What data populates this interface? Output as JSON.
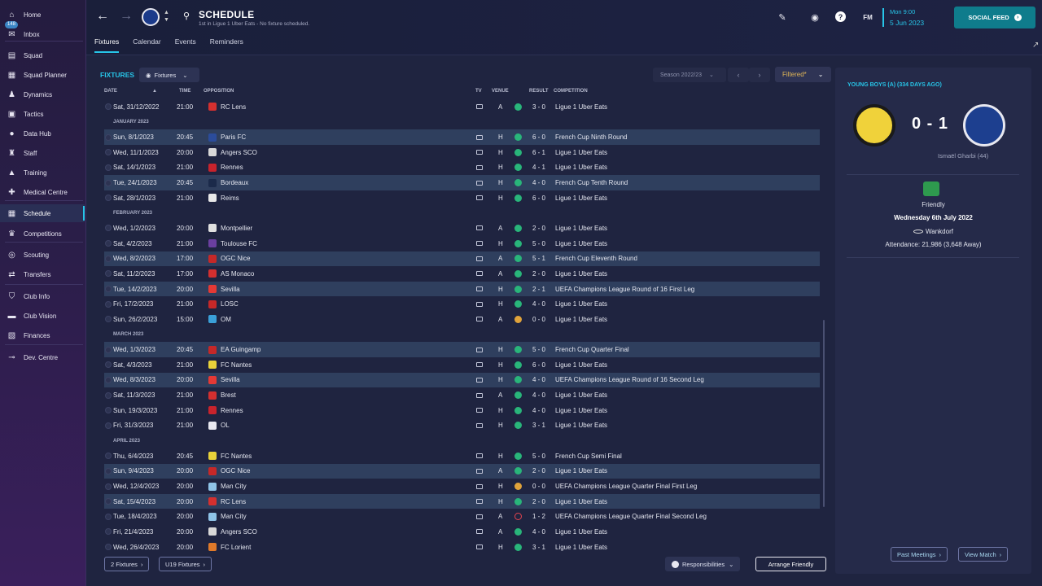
{
  "sidebar": {
    "items": [
      {
        "label": "Home",
        "icon": "home-icon"
      },
      {
        "label": "Inbox",
        "icon": "inbox-icon",
        "badge": "148"
      },
      {
        "label": "Squad",
        "icon": "shirt-icon"
      },
      {
        "label": "Squad Planner",
        "icon": "squad-planner-icon"
      },
      {
        "label": "Dynamics",
        "icon": "dynamics-icon"
      },
      {
        "label": "Tactics",
        "icon": "tactics-icon"
      },
      {
        "label": "Data Hub",
        "icon": "data-hub-icon"
      },
      {
        "label": "Staff",
        "icon": "staff-icon"
      },
      {
        "label": "Training",
        "icon": "training-icon"
      },
      {
        "label": "Medical Centre",
        "icon": "medical-icon"
      },
      {
        "label": "Schedule",
        "icon": "calendar-icon"
      },
      {
        "label": "Competitions",
        "icon": "trophy-icon"
      },
      {
        "label": "Scouting",
        "icon": "scouting-icon"
      },
      {
        "label": "Transfers",
        "icon": "transfers-icon"
      },
      {
        "label": "Club Info",
        "icon": "shield-icon"
      },
      {
        "label": "Club Vision",
        "icon": "club-vision-icon"
      },
      {
        "label": "Finances",
        "icon": "finances-icon"
      },
      {
        "label": "Dev. Centre",
        "icon": "dev-centre-icon"
      }
    ]
  },
  "header": {
    "title": "SCHEDULE",
    "subtitle": "1st in Ligue 1 Uber Eats - No fixture scheduled.",
    "tabs": [
      "Fixtures",
      "Calendar",
      "Events",
      "Reminders"
    ],
    "date_line1": "Mon 9:00",
    "date_line2": "5 Jun 2023",
    "fm_label": "FM",
    "social_label": "SOCIAL FEED"
  },
  "fixtures": {
    "label": "FIXTURES",
    "view_dropdown": "Fixtures",
    "season": "Season 2022/23",
    "filter": "Filtered*",
    "columns": {
      "date": "DATE",
      "time": "TIME",
      "opposition": "OPPOSITION",
      "tv": "TV",
      "venue": "VENUE",
      "result": "RESULT",
      "competition": "COMPETITION"
    },
    "rows": [
      {
        "date": "Sat, 31/12/2022",
        "time": "21:00",
        "opp": "RC Lens",
        "venue": "A",
        "res": "W",
        "score": "3 - 0",
        "comp": "Ligue 1 Uber Eats",
        "crest": "#d4302f"
      },
      {
        "section": "JANUARY 2023"
      },
      {
        "date": "Sun, 8/1/2023",
        "time": "20:45",
        "opp": "Paris FC",
        "venue": "H",
        "res": "W",
        "score": "6 - 0",
        "comp": "French Cup Ninth Round",
        "crest": "#2b4c9b"
      },
      {
        "date": "Wed, 11/1/2023",
        "time": "20:00",
        "opp": "Angers SCO",
        "venue": "H",
        "res": "W",
        "score": "6 - 1",
        "comp": "Ligue 1 Uber Eats",
        "crest": "#d8d8d8"
      },
      {
        "date": "Sat, 14/1/2023",
        "time": "21:00",
        "opp": "Rennes",
        "venue": "H",
        "res": "W",
        "score": "4 - 1",
        "comp": "Ligue 1 Uber Eats",
        "crest": "#c8232c"
      },
      {
        "date": "Tue, 24/1/2023",
        "time": "20:45",
        "opp": "Bordeaux",
        "venue": "H",
        "res": "W",
        "score": "4 - 0",
        "comp": "French Cup Tenth Round",
        "crest": "#1b2a4a"
      },
      {
        "date": "Sat, 28/1/2023",
        "time": "21:00",
        "opp": "Reims",
        "venue": "H",
        "res": "W",
        "score": "6 - 0",
        "comp": "Ligue 1 Uber Eats",
        "crest": "#e8e8e8"
      },
      {
        "section": "FEBRUARY 2023"
      },
      {
        "date": "Wed, 1/2/2023",
        "time": "20:00",
        "opp": "Montpellier",
        "venue": "A",
        "res": "W",
        "score": "2 - 0",
        "comp": "Ligue 1 Uber Eats",
        "crest": "#e0e0e0"
      },
      {
        "date": "Sat, 4/2/2023",
        "time": "21:00",
        "opp": "Toulouse FC",
        "venue": "H",
        "res": "W",
        "score": "5 - 0",
        "comp": "Ligue 1 Uber Eats",
        "crest": "#6b3fa0"
      },
      {
        "date": "Wed, 8/2/2023",
        "time": "17:00",
        "opp": "OGC Nice",
        "venue": "A",
        "res": "W",
        "score": "5 - 1",
        "comp": "French Cup Eleventh Round",
        "crest": "#c62828"
      },
      {
        "date": "Sat, 11/2/2023",
        "time": "17:00",
        "opp": "AS Monaco",
        "venue": "A",
        "res": "W",
        "score": "2 - 0",
        "comp": "Ligue 1 Uber Eats",
        "crest": "#d32f2f"
      },
      {
        "date": "Tue, 14/2/2023",
        "time": "20:00",
        "opp": "Sevilla",
        "venue": "H",
        "res": "W",
        "score": "2 - 1",
        "comp": "UEFA Champions League Round of 16  First Leg",
        "crest": "#e53935"
      },
      {
        "date": "Fri, 17/2/2023",
        "time": "21:00",
        "opp": "LOSC",
        "venue": "H",
        "res": "W",
        "score": "4 - 0",
        "comp": "Ligue 1 Uber Eats",
        "crest": "#c62828"
      },
      {
        "date": "Sun, 26/2/2023",
        "time": "15:00",
        "opp": "OM",
        "venue": "A",
        "res": "D",
        "score": "0 - 0",
        "comp": "Ligue 1 Uber Eats",
        "crest": "#3aa0d8"
      },
      {
        "section": "MARCH 2023"
      },
      {
        "date": "Wed, 1/3/2023",
        "time": "20:45",
        "opp": "EA Guingamp",
        "venue": "H",
        "res": "W",
        "score": "5 - 0",
        "comp": "French Cup Quarter Final",
        "crest": "#c62828"
      },
      {
        "date": "Sat, 4/3/2023",
        "time": "21:00",
        "opp": "FC Nantes",
        "venue": "H",
        "res": "W",
        "score": "6 - 0",
        "comp": "Ligue 1 Uber Eats",
        "crest": "#e8d23a"
      },
      {
        "date": "Wed, 8/3/2023",
        "time": "20:00",
        "opp": "Sevilla",
        "venue": "H",
        "res": "W",
        "score": "4 - 0",
        "comp": "UEFA Champions League Round of 16  Second Leg",
        "crest": "#e53935"
      },
      {
        "date": "Sat, 11/3/2023",
        "time": "21:00",
        "opp": "Brest",
        "venue": "A",
        "res": "W",
        "score": "4 - 0",
        "comp": "Ligue 1 Uber Eats",
        "crest": "#d32f2f"
      },
      {
        "date": "Sun, 19/3/2023",
        "time": "21:00",
        "opp": "Rennes",
        "venue": "H",
        "res": "W",
        "score": "4 - 0",
        "comp": "Ligue 1 Uber Eats",
        "crest": "#c8232c"
      },
      {
        "date": "Fri, 31/3/2023",
        "time": "21:00",
        "opp": "OL",
        "venue": "H",
        "res": "W",
        "score": "3 - 1",
        "comp": "Ligue 1 Uber Eats",
        "crest": "#e8e8f0"
      },
      {
        "section": "APRIL 2023"
      },
      {
        "date": "Thu, 6/4/2023",
        "time": "20:45",
        "opp": "FC Nantes",
        "venue": "H",
        "res": "W",
        "score": "5 - 0",
        "comp": "French Cup Semi Final",
        "crest": "#e8d23a"
      },
      {
        "date": "Sun, 9/4/2023",
        "time": "20:00",
        "opp": "OGC Nice",
        "venue": "A",
        "res": "W",
        "score": "2 - 0",
        "comp": "Ligue 1 Uber Eats",
        "crest": "#c62828"
      },
      {
        "date": "Wed, 12/4/2023",
        "time": "20:00",
        "opp": "Man City",
        "venue": "H",
        "res": "D",
        "score": "0 - 0",
        "comp": "UEFA Champions League Quarter Final First Leg",
        "crest": "#8fc4e8"
      },
      {
        "date": "Sat, 15/4/2023",
        "time": "20:00",
        "opp": "RC Lens",
        "venue": "H",
        "res": "W",
        "score": "2 - 0",
        "comp": "Ligue 1 Uber Eats",
        "crest": "#d4302f"
      },
      {
        "date": "Tue, 18/4/2023",
        "time": "20:00",
        "opp": "Man City",
        "venue": "A",
        "res": "L",
        "score": "1 - 2",
        "comp": "UEFA Champions League Quarter Final Second Leg",
        "crest": "#8fc4e8"
      },
      {
        "date": "Fri, 21/4/2023",
        "time": "20:00",
        "opp": "Angers SCO",
        "venue": "A",
        "res": "W",
        "score": "4 - 0",
        "comp": "Ligue 1 Uber Eats",
        "crest": "#d8d8d8"
      },
      {
        "date": "Wed, 26/4/2023",
        "time": "20:00",
        "opp": "FC Lorient",
        "venue": "H",
        "res": "W",
        "score": "3 - 1",
        "comp": "Ligue 1 Uber Eats",
        "crest": "#e07a2a"
      }
    ],
    "bottom_left": [
      "2 Fixtures",
      "U19 Fixtures"
    ],
    "responsibilities": "Responsibilities",
    "arrange_friendly": "Arrange Friendly"
  },
  "last_match": {
    "heading": "YOUNG BOYS (A) (334 DAYS AGO)",
    "score": "0 - 1",
    "scorer": "Ismaël Gharbi (44)",
    "competition": "Friendly",
    "date": "Wednesday 6th July 2022",
    "stadium": "Wankdorf",
    "attendance": "Attendance: 21,986 (3,648 Away)",
    "past_meetings": "Past Meetings",
    "view_match": "View Match"
  },
  "colors": {
    "accent": "#27c5e8",
    "win": "#29b57a",
    "draw": "#e0a33b",
    "loss": "#e0434e"
  }
}
